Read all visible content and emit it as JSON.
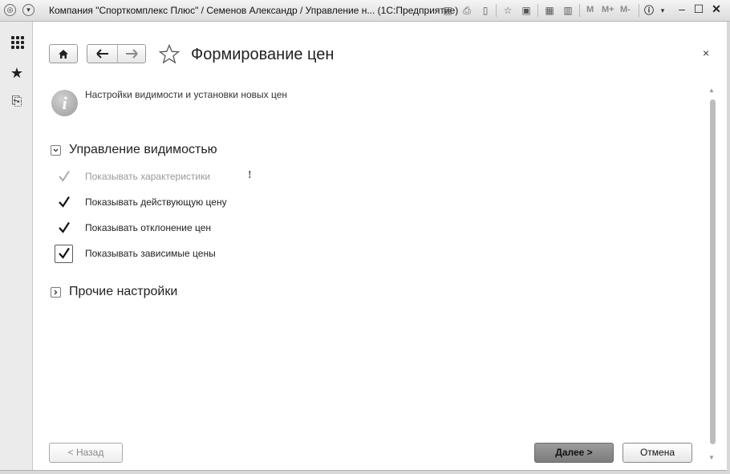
{
  "window": {
    "title": "Компания \"Спорткомплекс Плюс\" / Семенов Александр / Управление н...  (1С:Предприятие)",
    "m_labels": [
      "M",
      "M+",
      "M-"
    ]
  },
  "left_panel": {
    "items": [
      {
        "name": "sections-grid-icon"
      },
      {
        "name": "favorites-star-icon",
        "glyph": "★"
      },
      {
        "name": "history-icon",
        "glyph": "⎘"
      }
    ]
  },
  "header": {
    "title": "Формирование цен",
    "close_glyph": "×"
  },
  "info": {
    "text": "Настройки видимости и установки новых цен"
  },
  "groups": {
    "visibility": {
      "label": "Управление видимостью",
      "expanded": true,
      "items": [
        {
          "label": "Показывать характеристики",
          "checked": true,
          "enabled": false
        },
        {
          "label": "Показывать действующую цену",
          "checked": true,
          "enabled": true
        },
        {
          "label": "Показывать отклонение цен",
          "checked": true,
          "enabled": true
        },
        {
          "label": "Показывать зависимые цены",
          "checked": true,
          "enabled": true,
          "focused": true
        }
      ],
      "warning_glyph": "!"
    },
    "other": {
      "label": "Прочие настройки",
      "expanded": false
    }
  },
  "footer": {
    "back_label": "< Назад",
    "next_label": "Далее >",
    "cancel_label": "Отмена"
  },
  "colors": {
    "next_button_bg": "#8c8c8c",
    "disabled_text": "#9a9a9a"
  }
}
